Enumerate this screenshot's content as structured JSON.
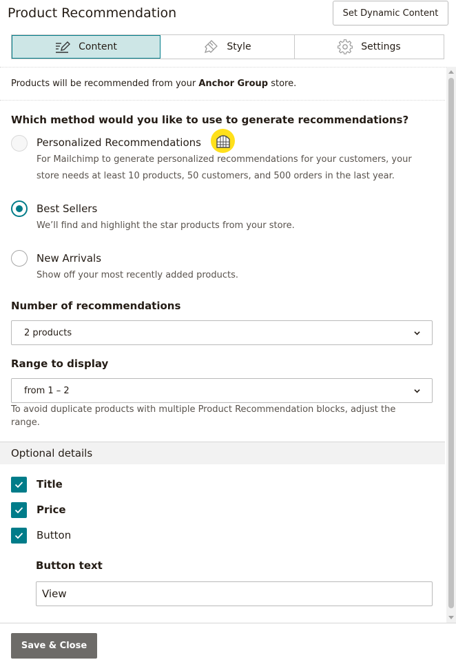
{
  "header": {
    "title": "Product Recommendation",
    "dynamic_button": "Set Dynamic Content"
  },
  "tabs": [
    {
      "label": "Content",
      "icon": "pencil-edit-icon",
      "active": true
    },
    {
      "label": "Style",
      "icon": "paint-brush-icon",
      "active": false
    },
    {
      "label": "Settings",
      "icon": "gear-icon",
      "active": false
    }
  ],
  "info": {
    "prefix": "Products will be recommended from your ",
    "store": "Anchor Group",
    "suffix": " store."
  },
  "method": {
    "question": "Which method would you like to use to generate recommendations?",
    "options": [
      {
        "label": "Personalized Recommendations",
        "description": "For Mailchimp to generate personalized recommendations for your customers, your store needs at least 10 products, 50 customers, and 500 orders in the last year.",
        "selected": false,
        "disabled": true
      },
      {
        "label": "Best Sellers",
        "description": "We’ll find and highlight the star products from your store.",
        "selected": true,
        "disabled": false
      },
      {
        "label": "New Arrivals",
        "description": "Show off your most recently added products.",
        "selected": false,
        "disabled": false
      }
    ]
  },
  "number_of_recommendations": {
    "label": "Number of recommendations",
    "value": "2 products"
  },
  "range": {
    "label": "Range to display",
    "value": "from 1 – 2",
    "help": "To avoid duplicate products with multiple Product Recommendation blocks, adjust the range."
  },
  "optional": {
    "heading": "Optional details",
    "items": [
      {
        "label": "Title",
        "checked": true
      },
      {
        "label": "Price",
        "checked": true
      },
      {
        "label": "Button",
        "checked": true
      }
    ],
    "button_text_label": "Button text",
    "button_text_value": "View"
  },
  "footer": {
    "save_label": "Save & Close"
  },
  "colors": {
    "accent": "#007c89",
    "tab_active_bg": "#cde6e6",
    "badge": "#ffe01b",
    "save_bg": "#6d6b68"
  }
}
